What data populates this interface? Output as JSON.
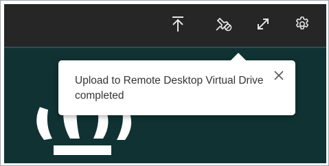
{
  "toolbar": {
    "buttons": [
      {
        "icon": "upload-icon"
      },
      {
        "icon": "unpin-icon"
      },
      {
        "icon": "fullscreen-icon"
      },
      {
        "icon": "gear-icon"
      }
    ],
    "background": "#262626",
    "icon_color": "#e6e6e6"
  },
  "notification": {
    "message": "Upload to Remote Desktop Virtual Drive completed",
    "close_icon": "close-icon"
  },
  "colors": {
    "desktop_background": "#103232",
    "toast_background": "#ffffff",
    "toast_text": "#333333"
  }
}
